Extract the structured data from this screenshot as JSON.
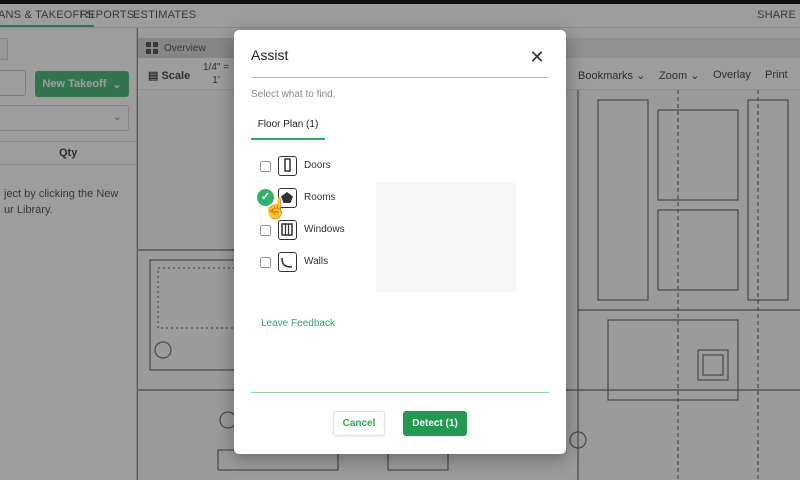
{
  "topnav": {
    "plans": "ANS & TAKEOFFS",
    "reports": "REPORTS",
    "estimates": "ESTIMATES",
    "share": "SHARE"
  },
  "left_panel": {
    "new_takeoff": "New Takeoff",
    "qty_header": "Qty",
    "empty_line1": "ject by clicking the New",
    "empty_line2": "ur Library."
  },
  "workspace": {
    "overview_tab": "Overview",
    "toolbar": {
      "scale": "Scale",
      "scale_value_line1": "1/4\" =",
      "scale_value_line2": "1'",
      "bookmarks": "Bookmarks",
      "zoom": "Zoom",
      "overlay": "Overlay",
      "print": "Print"
    }
  },
  "modal": {
    "title": "Assist",
    "subtitle": "Select what to find.",
    "tab": "Floor Plan (1)",
    "items": [
      {
        "label": "Doors",
        "icon": "door-icon",
        "checked": false
      },
      {
        "label": "Rooms",
        "icon": "room-pentagon-icon",
        "checked": true
      },
      {
        "label": "Windows",
        "icon": "window-icon",
        "checked": false
      },
      {
        "label": "Walls",
        "icon": "wall-icon",
        "checked": false
      }
    ],
    "feedback": "Leave Feedback",
    "cancel": "Cancel",
    "detect": "Detect (1)"
  },
  "colors": {
    "accent": "#27ae60",
    "accent_dark": "#1f9a4f"
  }
}
